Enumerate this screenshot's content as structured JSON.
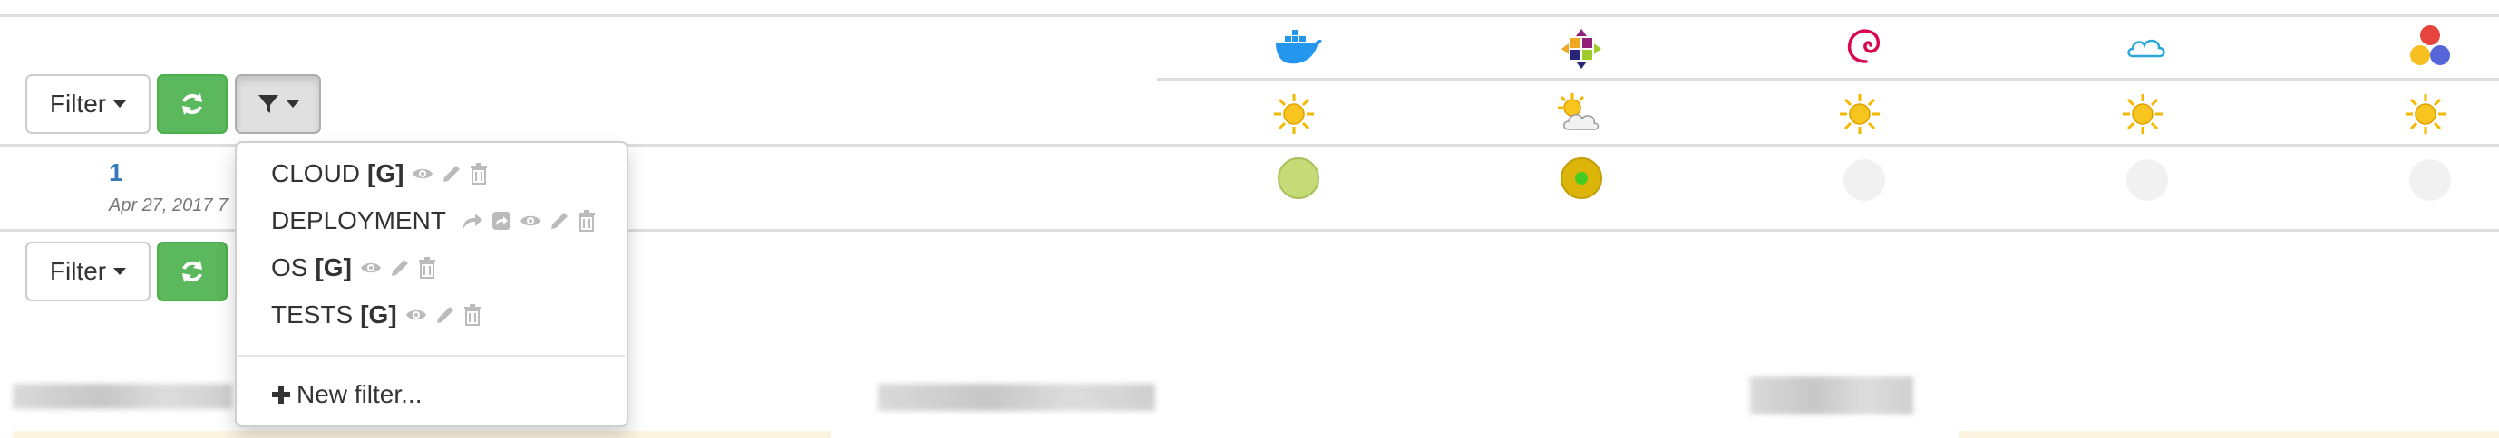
{
  "colors": {
    "success": "#5cb85c",
    "link": "#337ab7",
    "sun": "#f5b800",
    "ok_dot": "#c6da78",
    "warn_dot": "#dcb50a",
    "warn_center": "#44cc22",
    "empty_dot": "#f1f1f1"
  },
  "toolbar_top": {
    "filter_label": "Filter",
    "refresh_icon": "refresh-icon",
    "funnel_icon": "funnel-icon"
  },
  "toolbar_bottom": {
    "filter_label": "Filter",
    "refresh_icon": "refresh-icon"
  },
  "columns": [
    {
      "icon": "docker-icon",
      "weather": "sunny"
    },
    {
      "icon": "centos-icon",
      "weather": "partly-cloudy"
    },
    {
      "icon": "debian-icon",
      "weather": "sunny"
    },
    {
      "icon": "cloud-icon",
      "weather": "sunny"
    },
    {
      "icon": "three-circles-icon",
      "weather": "sunny"
    }
  ],
  "rows": [
    {
      "number": "1",
      "date": "Apr 27, 2017 7",
      "statuses": [
        "success",
        "running",
        "none",
        "none",
        "none"
      ]
    }
  ],
  "filter_menu": {
    "items": [
      {
        "label": "CLOUD",
        "tag": "[G]",
        "actions": [
          "eye-icon",
          "pencil-icon",
          "trash-icon"
        ]
      },
      {
        "label": "DEPLOYMENT",
        "tag": "",
        "actions": [
          "share-icon",
          "share-square-icon",
          "eye-icon",
          "pencil-icon",
          "trash-icon"
        ]
      },
      {
        "label": "OS",
        "tag": "[G]",
        "actions": [
          "eye-icon",
          "pencil-icon",
          "trash-icon"
        ]
      },
      {
        "label": "TESTS",
        "tag": "[G]",
        "actions": [
          "eye-icon",
          "pencil-icon",
          "trash-icon"
        ]
      }
    ],
    "new_filter_label": "New filter..."
  }
}
